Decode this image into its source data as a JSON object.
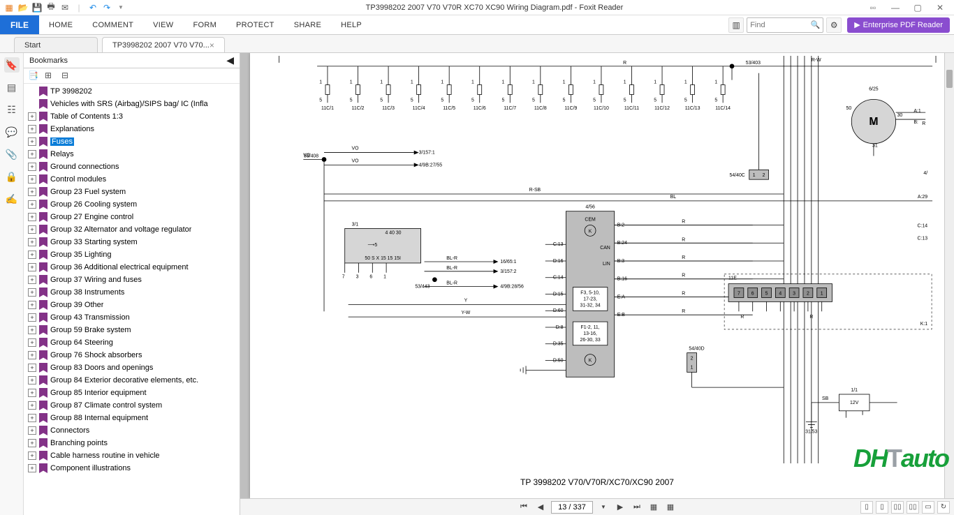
{
  "window": {
    "title": "TP3998202 2007 V70 V70R XC70 XC90 Wiring Diagram.pdf - Foxit Reader"
  },
  "menu": {
    "file": "FILE",
    "tabs": [
      "HOME",
      "COMMENT",
      "VIEW",
      "FORM",
      "PROTECT",
      "SHARE",
      "HELP"
    ],
    "search_placeholder": "Find",
    "enterprise": "Enterprise PDF Reader"
  },
  "doc_tabs": [
    {
      "label": "Start",
      "closable": false,
      "active": false
    },
    {
      "label": "TP3998202 2007 V70 V70...",
      "closable": true,
      "active": true
    }
  ],
  "bookmarks": {
    "title": "Bookmarks",
    "selected": "Fuses",
    "items": [
      {
        "label": "TP 3998202",
        "exp": ""
      },
      {
        "label": "Vehicles with SRS (Airbag)/SIPS bag/ IC (Infla",
        "exp": ""
      },
      {
        "label": "Table of Contents 1:3",
        "exp": "+"
      },
      {
        "label": "Explanations",
        "exp": "+"
      },
      {
        "label": "Fuses",
        "exp": "+"
      },
      {
        "label": "Relays",
        "exp": "+"
      },
      {
        "label": "Ground connections",
        "exp": "+"
      },
      {
        "label": "Control modules",
        "exp": "+"
      },
      {
        "label": "Group 23 Fuel system",
        "exp": "+"
      },
      {
        "label": "Group 26 Cooling system",
        "exp": "+"
      },
      {
        "label": "Group 27 Engine control",
        "exp": "+"
      },
      {
        "label": "Group 32 Alternator and voltage regulator",
        "exp": "+"
      },
      {
        "label": "Group 33 Starting system",
        "exp": "+"
      },
      {
        "label": "Group 35 Lighting",
        "exp": "+"
      },
      {
        "label": "Group 36 Additional electrical equipment",
        "exp": "+"
      },
      {
        "label": "Group 37 Wiring and fuses",
        "exp": "+"
      },
      {
        "label": "Group 38 Instruments",
        "exp": "+"
      },
      {
        "label": "Group 39 Other",
        "exp": "+"
      },
      {
        "label": "Group 43 Transmission",
        "exp": "+"
      },
      {
        "label": "Group 59 Brake system",
        "exp": "+"
      },
      {
        "label": "Group 64 Steering",
        "exp": "+"
      },
      {
        "label": "Group 76 Shock absorbers",
        "exp": "+"
      },
      {
        "label": "Group 83 Doors and openings",
        "exp": "+"
      },
      {
        "label": "Group 84 Exterior decorative elements, etc.",
        "exp": "+"
      },
      {
        "label": "Group 85 Interior equipment",
        "exp": "+"
      },
      {
        "label": "Group 87 Climate control system",
        "exp": "+"
      },
      {
        "label": "Group 88 Internal equipment",
        "exp": "+"
      },
      {
        "label": "Connectors",
        "exp": "+"
      },
      {
        "label": "Branching points",
        "exp": "+"
      },
      {
        "label": "Cable harness routine in vehicle",
        "exp": "+"
      },
      {
        "label": "Component illustrations",
        "exp": "+"
      }
    ]
  },
  "page": {
    "caption": "TP 3998202 V70/V70R/XC70/XC90 2007",
    "current": "13 / 337"
  },
  "diagram_labels": {
    "top_node": "53/403",
    "fuse_row": [
      "11C/1",
      "11C/2",
      "11C/3",
      "11C/4",
      "11C/5",
      "11C/6",
      "11C/7",
      "11C/8",
      "11C/9",
      "11C/10",
      "11C/11",
      "11C/12",
      "11C/13",
      "11C/14"
    ],
    "motor": {
      "name": "6/25",
      "center": "M",
      "pins": [
        "50",
        "30",
        "31"
      ],
      "right": [
        "A:1",
        "B:",
        "A"
      ]
    },
    "left_node": "53/408",
    "left_refs": [
      "3/157:1",
      "4/9B:27/55"
    ],
    "wires": {
      "VO": "VO",
      "RSB": "R-SB",
      "BL": "BL",
      "Y": "Y",
      "YW": "Y-W",
      "R": "R",
      "BLR": "BL-R",
      "SB": "SB",
      "RW": "R-W"
    },
    "box31": {
      "name": "3/1",
      "pins_top": [
        "4",
        "40",
        "30"
      ],
      "arrow": "5",
      "pins_bot": [
        "50",
        "S",
        "X",
        "15",
        "15",
        "15I"
      ],
      "ext": [
        "7",
        "3",
        "6",
        "1"
      ]
    },
    "mid_node": "53/443",
    "mid_refs": [
      "16/65:1",
      "3/157:2",
      "4/9B:28/56"
    ],
    "cem": {
      "name": "4/56",
      "title": "CEM",
      "pins_left": [
        "C:13",
        "D:16",
        "C:14",
        "D:15",
        "D:60",
        "D:8",
        "D:35",
        "D:50"
      ],
      "pins_right": [
        "B:2",
        "B:24",
        "B:3",
        "B:16",
        "E:A",
        "E:B"
      ],
      "bus": [
        "CAN",
        "LIN"
      ],
      "f1": "F3, 5-10,\n17-23,\n31-32, 34",
      "f2": "F1-2, 11,\n13-16,\n26-30, 33"
    },
    "relay1": {
      "name": "54/40C",
      "pins": [
        "1",
        "2"
      ]
    },
    "relay2": {
      "name": "54/40D",
      "pins": [
        "2",
        "1"
      ]
    },
    "connector11E": {
      "name": "11E",
      "pins": [
        "7",
        "6",
        "5",
        "4",
        "3",
        "2",
        "1"
      ]
    },
    "battery": {
      "name": "1/1",
      "volt": "12V"
    },
    "ground": "31/53",
    "edge_right": [
      "C:14",
      "C:13",
      "A:29",
      "4/",
      "K:1"
    ]
  },
  "watermark": {
    "a": "DH",
    "b": "T",
    "c": "auto"
  }
}
